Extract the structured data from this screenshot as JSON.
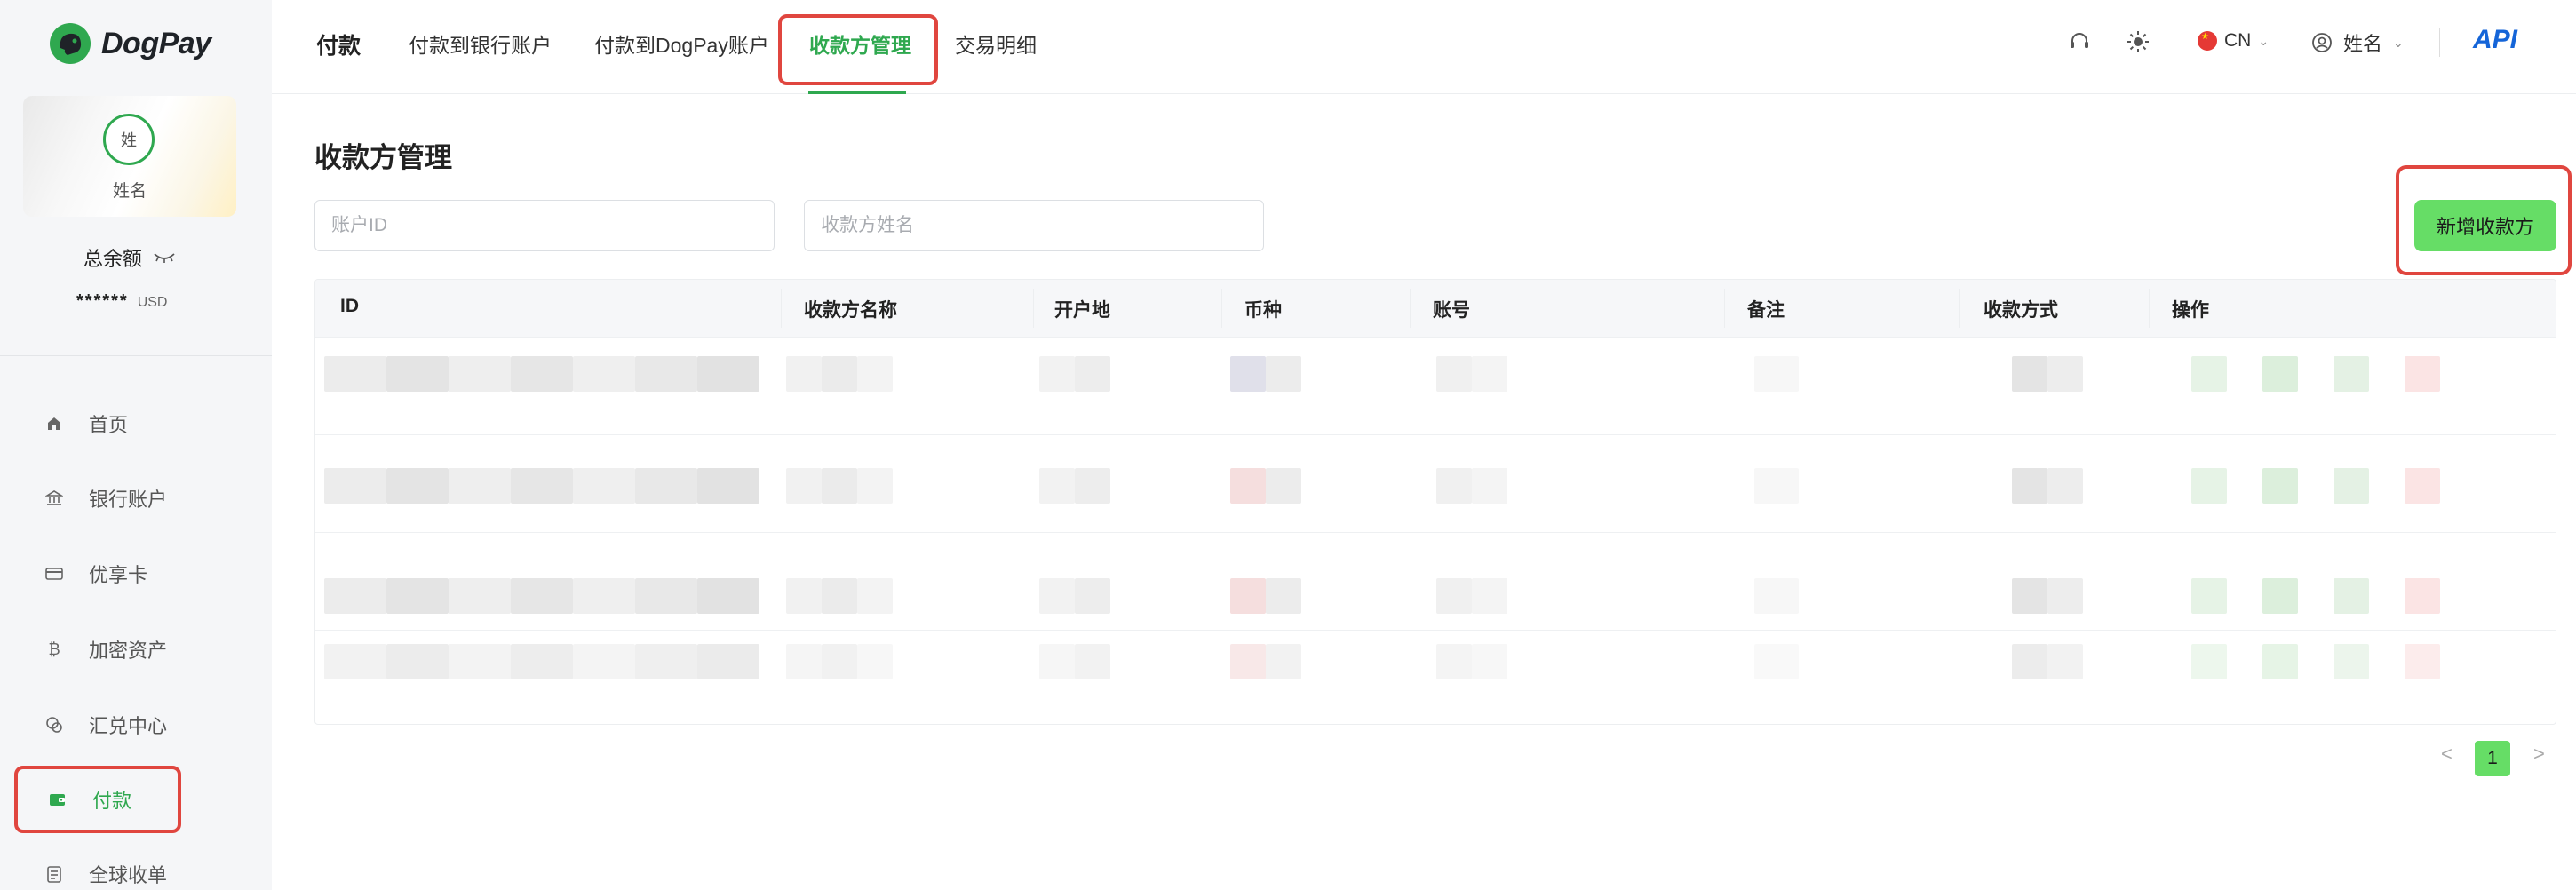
{
  "brand": {
    "name": "DogPay",
    "accent": "#2fa84f",
    "button_green": "#66dd66",
    "highlight_red": "#e0463f"
  },
  "profile": {
    "avatar_text": "姓",
    "name": "姓名"
  },
  "balance": {
    "label": "总余额",
    "value": "******",
    "unit": "USD",
    "visibility_icon": "eye-closed-icon"
  },
  "sidebar": {
    "items": [
      {
        "label": "首页",
        "icon": "home-icon"
      },
      {
        "label": "银行账户",
        "icon": "bank-icon"
      },
      {
        "label": "优享卡",
        "icon": "card-icon"
      },
      {
        "label": "加密资产",
        "icon": "bitcoin-icon"
      },
      {
        "label": "汇兑中心",
        "icon": "exchange-icon"
      },
      {
        "label": "付款",
        "icon": "wallet-icon",
        "active": true
      },
      {
        "label": "全球收单",
        "icon": "receipt-icon"
      }
    ]
  },
  "topbar": {
    "title": "付款",
    "tabs": [
      {
        "label": "付款到银行账户"
      },
      {
        "label": "付款到DogPay账户"
      },
      {
        "label": "收款方管理",
        "active": true
      },
      {
        "label": "交易明细"
      }
    ],
    "language": "CN",
    "user": "姓名",
    "api": "API"
  },
  "main": {
    "title": "收款方管理",
    "filters": {
      "account_id_placeholder": "账户ID",
      "payee_name_placeholder": "收款方姓名"
    },
    "add_button": "新增收款方",
    "table": {
      "columns": [
        "ID",
        "收款方名称",
        "开户地",
        "币种",
        "账号",
        "备注",
        "收款方式",
        "操作"
      ]
    },
    "pagination": {
      "prev": "<",
      "current": "1",
      "next": ">"
    }
  }
}
